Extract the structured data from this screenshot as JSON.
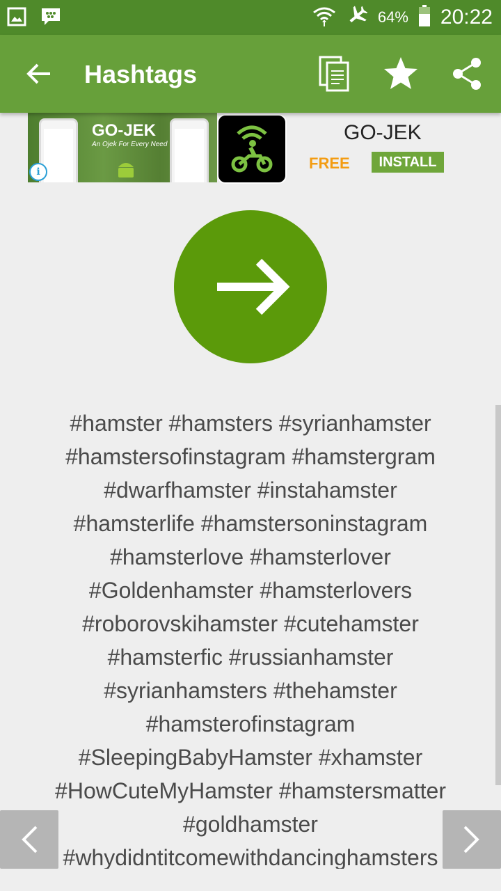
{
  "status_bar": {
    "battery_percent": "64%",
    "time": "20:22",
    "icons": [
      "gallery-icon",
      "bbm-icon",
      "wifi-icon",
      "airplane-icon",
      "battery-icon"
    ]
  },
  "app_bar": {
    "title": "Hashtags",
    "actions": [
      "copy-icon",
      "star-icon",
      "share-icon"
    ]
  },
  "ad": {
    "brand": "GO-JEK",
    "tagline": "An Ojek For Every Need",
    "app_name": "GO-JEK",
    "price_label": "FREE",
    "install_label": "INSTALL"
  },
  "main": {
    "go_button_icon": "arrow-right-icon",
    "hashtag_lines": [
      "#hamster #hamsters #syrianhamster",
      "#hamstersofinstagram #hamstergram",
      "#dwarfhamster #instahamster",
      "#hamsterlife #hamstersoninstagram",
      "#hamsterlove #hamsterlover",
      "#Goldenhamster #hamsterlovers",
      "#roborovskihamster #cutehamster",
      "#hamsterfic #russianhamster",
      "#syrianhamsters #thehamster",
      "#hamsterofinstagram",
      "#SleepingBabyHamster #xhamster",
      "#HowCuteMyHamster #hamstersmatter",
      "#goldhamster",
      "#whydidntitcomewithdancinghamsters"
    ]
  },
  "colors": {
    "status_bar": "#4f8a2a",
    "app_bar": "#67a03a",
    "go_circle": "#5b9a0a",
    "free_text": "#f39c12"
  }
}
